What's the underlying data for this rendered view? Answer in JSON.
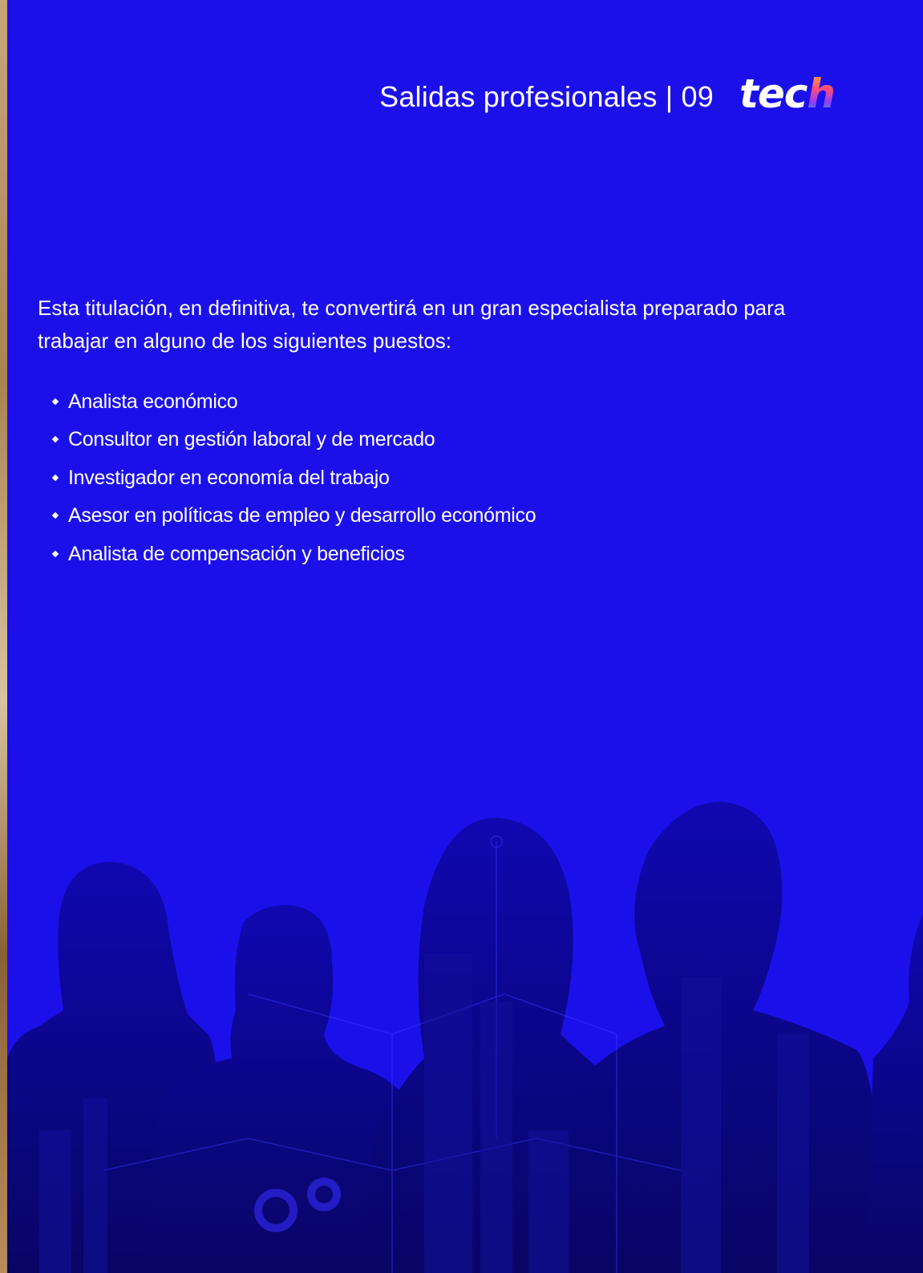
{
  "header": {
    "section_title": "Salidas profesionales | 09",
    "logo_main": "tec",
    "logo_accent": "h"
  },
  "content": {
    "intro": "Esta titulación, en definitiva, te convertirá en un gran especialista preparado para trabajar en alguno de los siguientes puestos:",
    "jobs": [
      "Analista económico",
      "Consultor en gestión laboral y de mercado",
      "Investigador en economía del trabajo",
      "Asesor en políticas de empleo y desarrollo económico",
      "Analista de compensación y beneficios"
    ]
  },
  "colors": {
    "background": "#1c10ea",
    "text": "#ffffff",
    "silhouette": "#0d0a8a"
  },
  "icons": {
    "bullet": "diamond-bullet-icon",
    "logo": "tech-logo",
    "illustration": "people-city-silhouettes"
  }
}
